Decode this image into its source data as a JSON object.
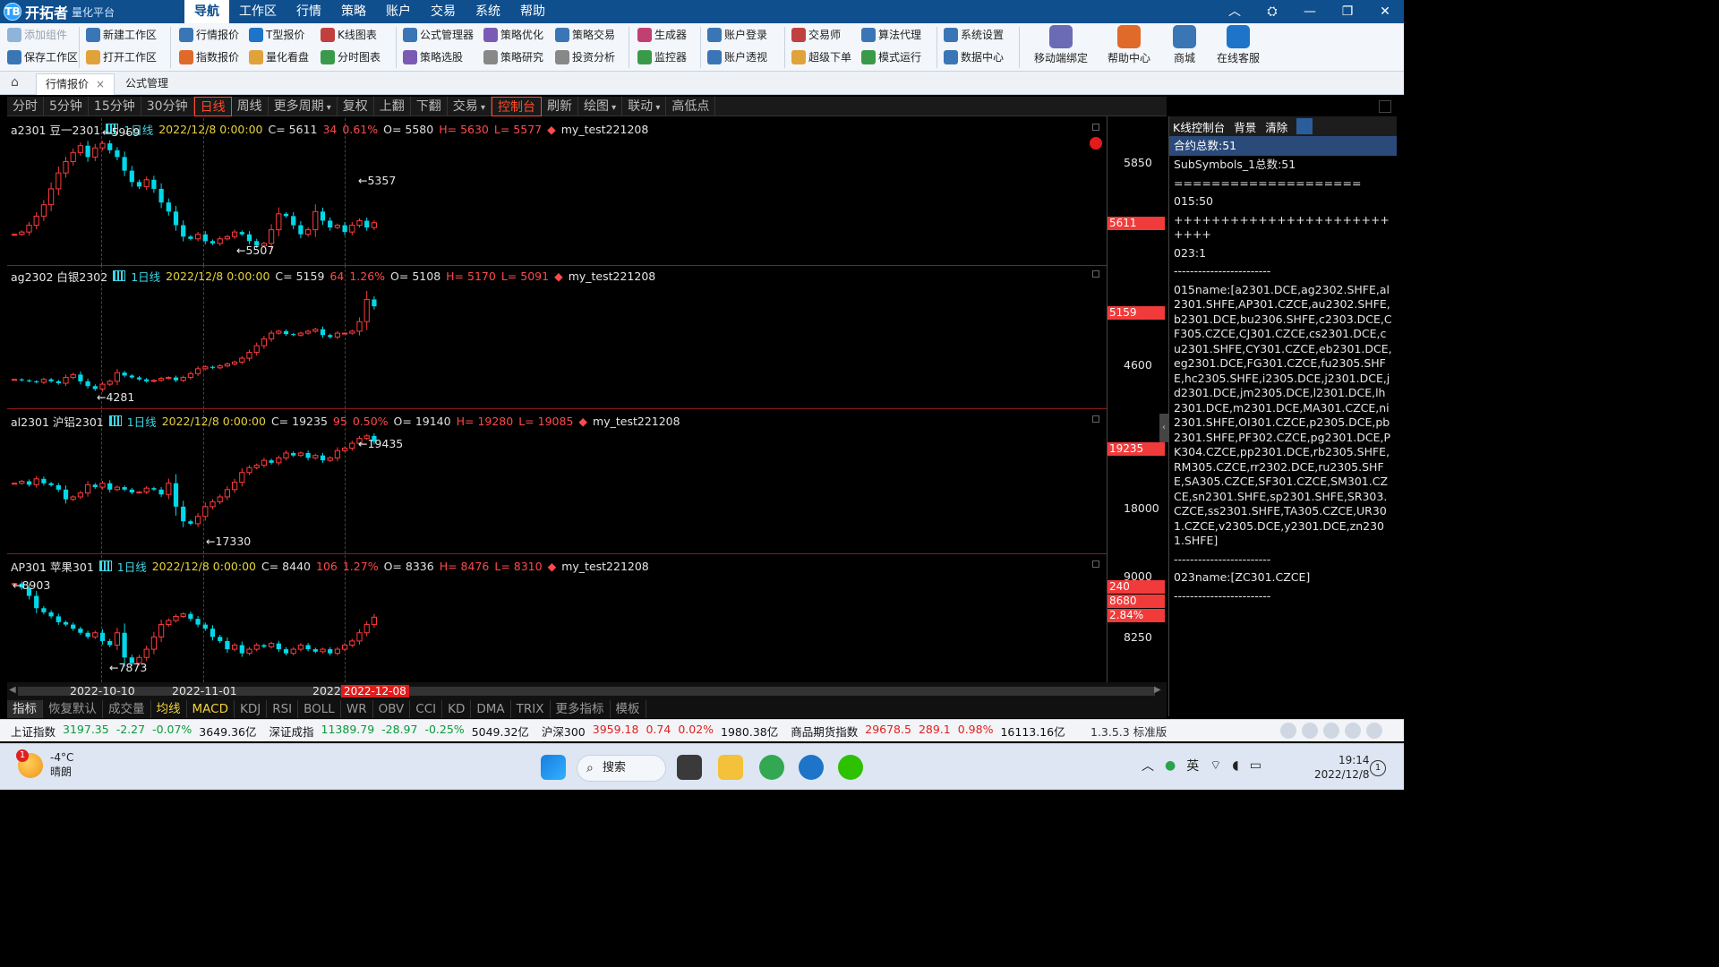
{
  "app": {
    "logo_mark": "TB",
    "name": "开拓者",
    "sub": "量化平台",
    "menu": [
      "导航",
      "工作区",
      "行情",
      "策略",
      "账户",
      "交易",
      "系统",
      "帮助"
    ],
    "active_menu": "导航",
    "window_controls": [
      "︿",
      "⛭",
      "—",
      "❐",
      "✕"
    ]
  },
  "ribbon": {
    "col1": [
      "添加组件",
      "保存工作区"
    ],
    "col2": [
      "新建工作区",
      "打开工作区"
    ],
    "col3": [
      "行情报价",
      "指数报价"
    ],
    "col4": [
      "T型报价",
      "量化看盘"
    ],
    "col5": [
      "K线图表",
      "分时图表"
    ],
    "col6": [
      "公式管理器",
      "策略选股"
    ],
    "col7": [
      "策略优化",
      "策略研究"
    ],
    "col8": [
      "策略交易",
      "投资分析"
    ],
    "col9": [
      "生成器",
      "监控器"
    ],
    "col10": [
      "账户登录",
      "账户透视"
    ],
    "col11": [
      "交易师",
      "超级下单"
    ],
    "col12": [
      "算法代理",
      "模式运行"
    ],
    "col13": [
      "系统设置",
      "数据中心"
    ],
    "big": [
      "移动端绑定",
      "帮助中心",
      "商城",
      "在线客服"
    ]
  },
  "tabs": {
    "items": [
      {
        "label": "行情报价",
        "close": "×",
        "active": true
      },
      {
        "label": "公式管理",
        "close": "",
        "active": false
      }
    ]
  },
  "periodbar": {
    "items": [
      "分时",
      "5分钟",
      "15分钟",
      "30分钟",
      "日线",
      "周线",
      "更多周期",
      "复权",
      "上翻",
      "下翻",
      "交易",
      "控制台",
      "刷新",
      "绘图",
      "联动",
      "高低点"
    ],
    "highlight": [
      "日线",
      "控制台"
    ]
  },
  "panels": [
    {
      "symbol": "a2301 豆一2301",
      "period": "1日线",
      "datetime": "2022/12/8 0:00:00",
      "close": "C= 5611",
      "change": "34",
      "pct": "0.61%",
      "open": "O= 5580",
      "high": "H= 5630",
      "low": "L= 5577",
      "strategy": "my_test221208",
      "ext_high": "5969",
      "ext_low": "5507",
      "axis_ticks": [
        "5850"
      ],
      "price_tag": "5611",
      "ylim": [
        5480,
        6000
      ],
      "closes": [
        5560,
        5570,
        5600,
        5640,
        5690,
        5760,
        5830,
        5880,
        5920,
        5950,
        5900,
        5940,
        5960,
        5930,
        5900,
        5840,
        5790,
        5770,
        5800,
        5760,
        5700,
        5660,
        5600,
        5550,
        5540,
        5560,
        5530,
        5520,
        5540,
        5550,
        5570,
        5560,
        5530,
        5510,
        5520,
        5580,
        5650,
        5640,
        5600,
        5560,
        5580,
        5660,
        5620,
        5590,
        5600,
        5570,
        5600,
        5620,
        5590,
        5611
      ]
    },
    {
      "symbol": "ag2302 白银2302",
      "period": "1日线",
      "datetime": "2022/12/8 0:00:00",
      "close": "C= 5159",
      "change": "64",
      "pct": "1.26%",
      "open": "O= 5108",
      "high": "H= 5170",
      "low": "L= 5091",
      "strategy": "my_test221208",
      "ext_high": "5357",
      "ext_low": "4281",
      "axis_ticks": [
        "4600"
      ],
      "price_tag": "5159",
      "ylim": [
        4230,
        5420
      ],
      "closes": [
        4400,
        4390,
        4380,
        4370,
        4400,
        4380,
        4360,
        4420,
        4450,
        4380,
        4330,
        4300,
        4350,
        4380,
        4470,
        4440,
        4420,
        4400,
        4380,
        4390,
        4410,
        4420,
        4390,
        4420,
        4460,
        4510,
        4530,
        4520,
        4540,
        4560,
        4580,
        4620,
        4680,
        4750,
        4820,
        4880,
        4900,
        4870,
        4860,
        4880,
        4900,
        4920,
        4860,
        4840,
        4880,
        4880,
        4900,
        5000,
        5230,
        5159
      ]
    },
    {
      "symbol": "al2301 沪铝2301",
      "period": "1日线",
      "datetime": "2022/12/8 0:00:00",
      "close": "C= 19235",
      "change": "95",
      "pct": "0.50%",
      "open": "O= 19140",
      "high": "H= 19280",
      "low": "L= 19085",
      "strategy": "my_test221208",
      "ext_high": "19435",
      "ext_low": "17330",
      "axis_ticks": [
        "18000"
      ],
      "price_tag": "19235",
      "ylim": [
        17200,
        19550
      ],
      "closes": [
        18380,
        18420,
        18350,
        18470,
        18380,
        18340,
        18250,
        18050,
        18100,
        18180,
        18350,
        18300,
        18380,
        18250,
        18300,
        18250,
        18190,
        18200,
        18280,
        18250,
        18150,
        18380,
        17900,
        17600,
        17550,
        17700,
        17900,
        18000,
        18100,
        18250,
        18400,
        18600,
        18700,
        18750,
        18850,
        18800,
        18900,
        19000,
        18950,
        19000,
        18900,
        18950,
        18850,
        18900,
        19050,
        19100,
        19200,
        19300,
        19350,
        19235
      ]
    },
    {
      "symbol": "AP301 苹果301",
      "period": "1日线",
      "datetime": "2022/12/8 0:00:00",
      "close": "C= 8440",
      "change": "106",
      "pct": "1.27%",
      "open": "O= 8336",
      "high": "H= 8476",
      "low": "L= 8310",
      "strategy": "my_test221208",
      "ext_high": "8903",
      "ext_low": "7873",
      "axis_ticks": [
        "9000",
        "8250"
      ],
      "price_tags": [
        "240",
        "8680",
        "2.84%"
      ],
      "ylim": [
        7800,
        9000
      ],
      "closes": [
        8850,
        8800,
        8700,
        8550,
        8500,
        8450,
        8380,
        8350,
        8300,
        8250,
        8200,
        8250,
        8150,
        8100,
        8250,
        7950,
        7880,
        7950,
        8050,
        8200,
        8350,
        8400,
        8450,
        8480,
        8420,
        8350,
        8300,
        8200,
        8150,
        8050,
        8100,
        8000,
        8050,
        8100,
        8080,
        8120,
        8050,
        8000,
        8050,
        8100,
        8050,
        8020,
        8050,
        8000,
        8050,
        8100,
        8150,
        8250,
        8350,
        8440
      ]
    }
  ],
  "datebar": {
    "dates": [
      "2022-10-10",
      "2022-11-01",
      "2022-"
    ],
    "highlight": "2022-12-08"
  },
  "indicators": {
    "items": [
      "指标",
      "恢复默认",
      "成交量",
      "均线",
      "MACD",
      "KDJ",
      "RSI",
      "BOLL",
      "WR",
      "OBV",
      "CCI",
      "KD",
      "DMA",
      "TRIX",
      "更多指标",
      "模板"
    ]
  },
  "console": {
    "title": "K线控制台",
    "bg": "背景",
    "clear": "清除",
    "subhead": "合约总数:51",
    "lines": [
      "SubSymbols_1总数:51",
      "====================",
      "015:50",
      "+++++++++++++++++++++++++++",
      "023:1",
      "------------------------",
      "015name:[a2301.DCE,ag2302.SHFE,al2301.SHFE,AP301.CZCE,au2302.SHFE,b2301.DCE,bu2306.SHFE,c2303.DCE,CF305.CZCE,CJ301.CZCE,cs2301.DCE,cu2301.SHFE,CY301.CZCE,eb2301.DCE,eg2301.DCE,FG301.CZCE,fu2305.SHFE,hc2305.SHFE,i2305.DCE,j2301.DCE,jd2301.DCE,jm2305.DCE,l2301.DCE,lh2301.DCE,m2301.DCE,MA301.CZCE,ni2301.SHFE,OI301.CZCE,p2305.DCE,pb2301.SHFE,PF302.CZCE,pg2301.DCE,PK304.CZCE,pp2301.DCE,rb2305.SHFE,RM305.CZCE,rr2302.DCE,ru2305.SHFE,SA305.CZCE,SF301.CZCE,SM301.CZCE,sn2301.SHFE,sp2301.SHFE,SR303.CZCE,ss2301.SHFE,TA305.CZCE,UR301.CZCE,v2305.DCE,y2301.DCE,zn2301.SHFE]",
      "------------------------",
      "023name:[ZC301.CZCE]",
      "------------------------"
    ]
  },
  "status": {
    "items": [
      {
        "label": "上证指数",
        "price": "3197.35",
        "chg": "-2.27",
        "pct": "-0.07%",
        "amt": "3649.36亿",
        "dir": "dn"
      },
      {
        "label": "深证成指",
        "price": "11389.79",
        "chg": "-28.97",
        "pct": "-0.25%",
        "amt": "5049.32亿",
        "dir": "dn"
      },
      {
        "label": "沪深300",
        "price": "3959.18",
        "chg": "0.74",
        "pct": "0.02%",
        "amt": "1980.38亿",
        "dir": "up"
      },
      {
        "label": "商品期货指数",
        "price": "29678.5",
        "chg": "289.1",
        "pct": "0.98%",
        "amt": "16113.16亿",
        "dir": "up"
      }
    ],
    "version": "1.3.5.3 标准版"
  },
  "taskbar": {
    "weather_badge": "1",
    "temp": "-4°C",
    "cond": "晴朗",
    "search": "搜索",
    "ime": "英",
    "time": "19:14",
    "date": "2022/12/8",
    "notif": "1"
  },
  "colors": {
    "up": "#ff3b3b",
    "down": "#00d8e8",
    "accent": "#0f4f8e"
  }
}
